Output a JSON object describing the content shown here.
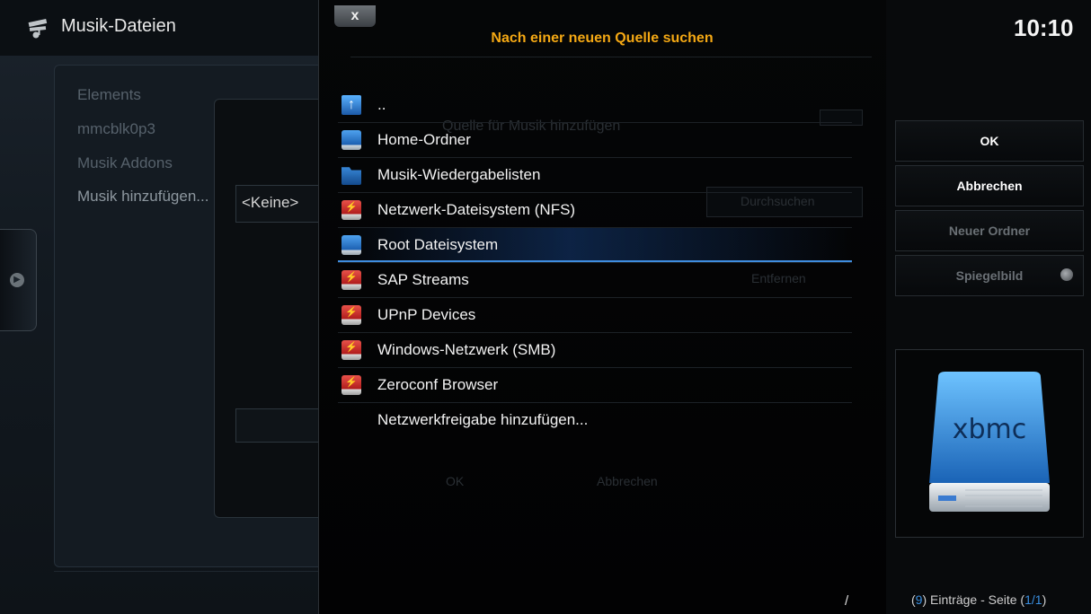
{
  "background_app": {
    "title": "Musik-Dateien",
    "menu_items": [
      "Elements",
      "mmcblk0p3",
      "Musik Addons",
      "Musik hinzufügen..."
    ],
    "keine_label": "<Keine>"
  },
  "dialog": {
    "close_label": "x",
    "title": "Nach einer neuen Quelle suchen",
    "title_color": "#f4a814",
    "ghost_texts": {
      "subtitle": "Quelle für Musik hinzufügen",
      "browse": "Durchsuchen",
      "remove": "Entfernen",
      "ok": "OK",
      "cancel": "Abbrechen"
    },
    "items": [
      {
        "label": "..",
        "icon": "up-arrow-icon"
      },
      {
        "label": "Home-Ordner",
        "icon": "drive-blue-icon"
      },
      {
        "label": "Musik-Wiedergabelisten",
        "icon": "folder-icon"
      },
      {
        "label": "Netzwerk-Dateisystem (NFS)",
        "icon": "network-drive-icon"
      },
      {
        "label": "Root Dateisystem",
        "icon": "drive-blue-icon",
        "selected": true
      },
      {
        "label": "SAP Streams",
        "icon": "network-drive-icon"
      },
      {
        "label": "UPnP Devices",
        "icon": "network-drive-icon"
      },
      {
        "label": "Windows-Netzwerk (SMB)",
        "icon": "network-drive-icon"
      },
      {
        "label": "Zeroconf Browser",
        "icon": "network-drive-icon"
      },
      {
        "label": "Netzwerkfreigabe hinzufügen...",
        "icon": ""
      }
    ],
    "path": "/"
  },
  "right_panel": {
    "clock": "10:10",
    "buttons": {
      "ok": "OK",
      "cancel": "Abbrechen",
      "new_folder": "Neuer Ordner",
      "mirror": "Spiegelbild"
    },
    "preview_logo_text": "xbmc",
    "footer": {
      "count": "9",
      "count_open": "(",
      "count_close": ")",
      "middle": " Einträge - Seite ",
      "page": "1/1",
      "page_open": "(",
      "page_close": ")"
    }
  }
}
